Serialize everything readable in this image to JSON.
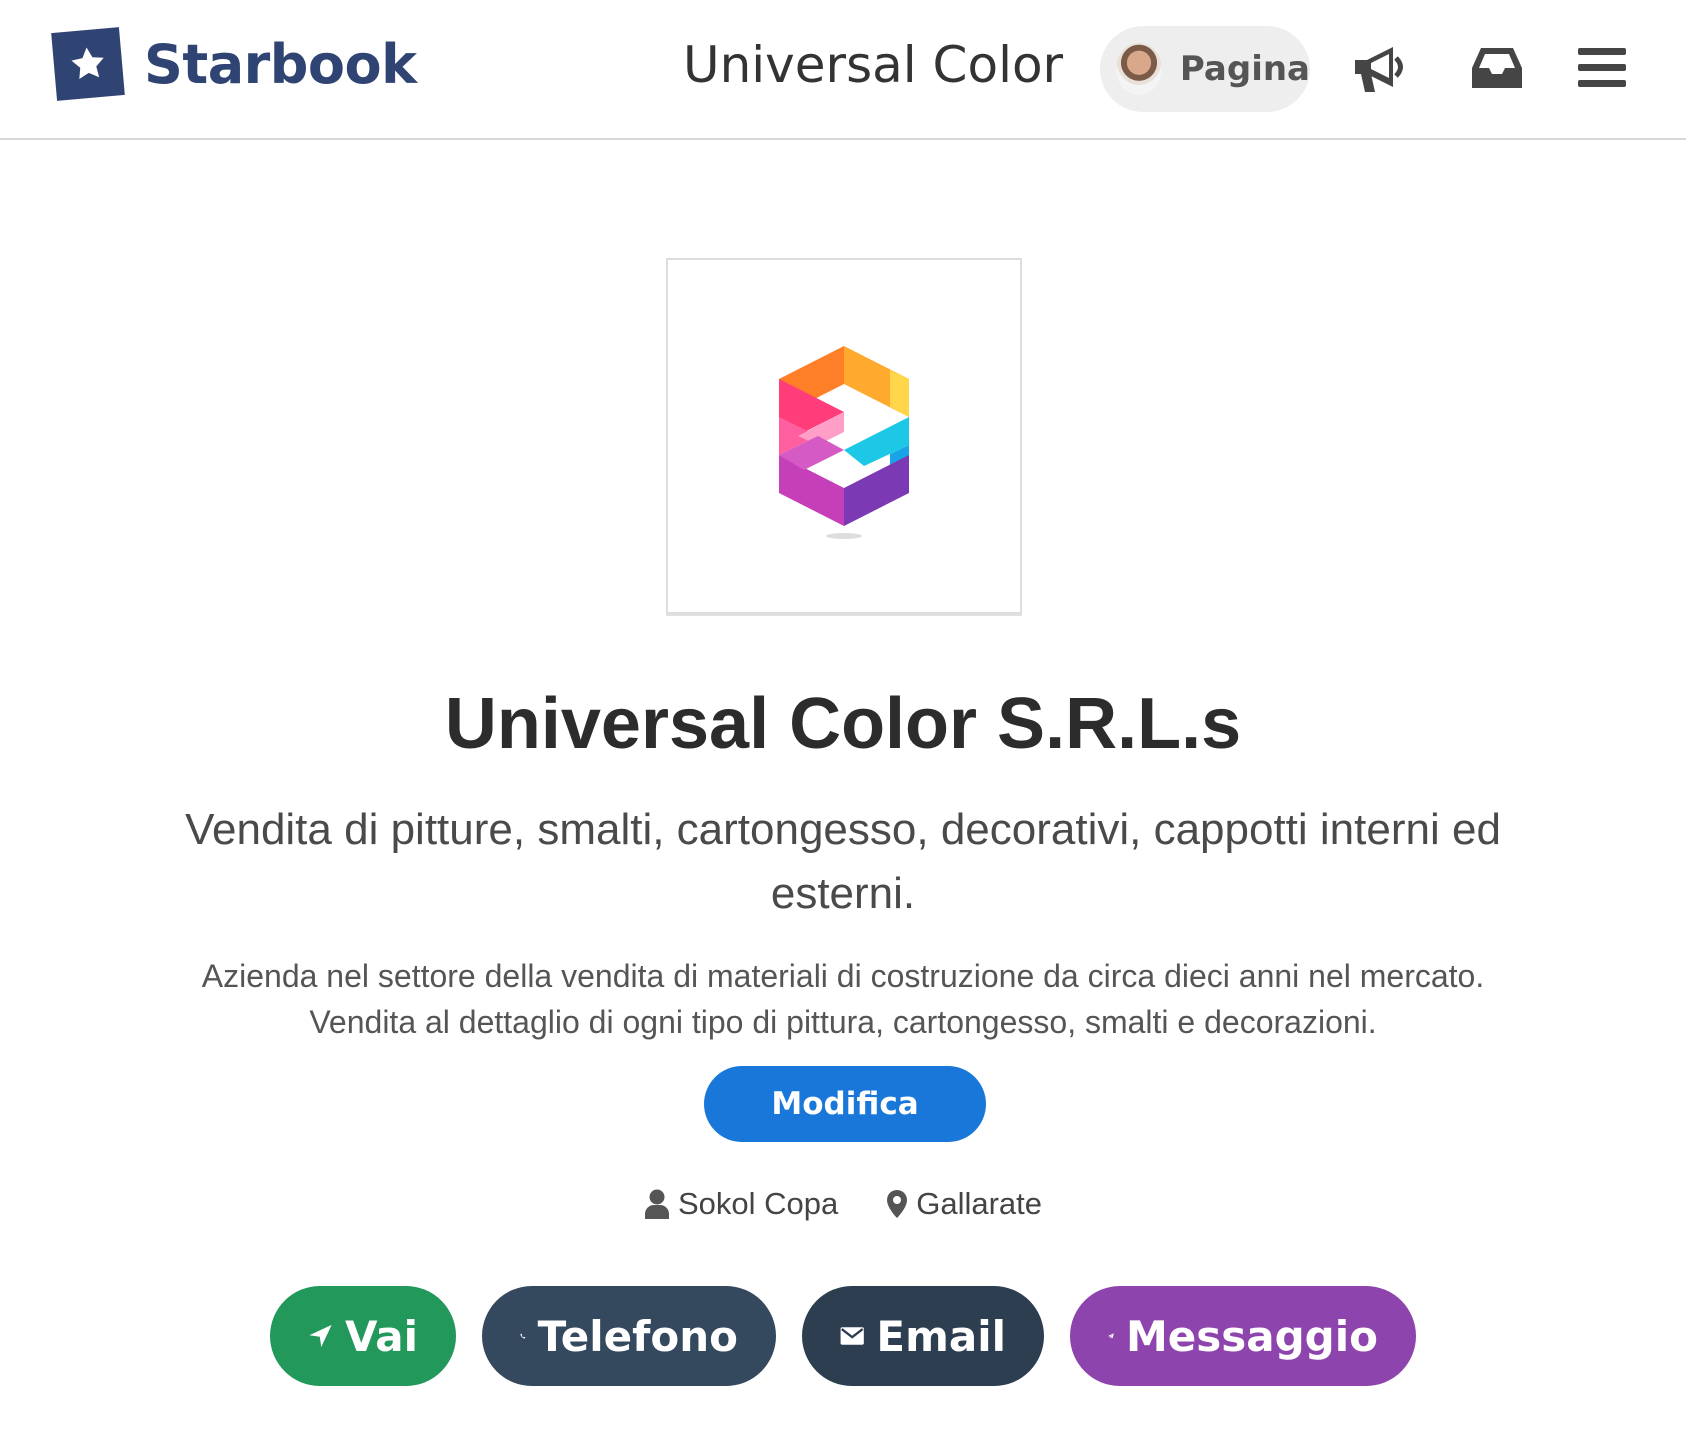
{
  "brand": {
    "name": "Starbook"
  },
  "header": {
    "page_title": "Universal Color",
    "pagina_label": "Pagina"
  },
  "profile": {
    "title": "Universal Color S.R.L.s",
    "subtitle": "Vendita di pitture, smalti, cartongesso, decorativi, cappotti interni ed esterni.",
    "description_line1": "Azienda nel settore della vendita di materiali di costruzione da circa dieci anni nel mercato.",
    "description_line2": "Vendita al dettaglio di ogni tipo di pittura, cartongesso, smalti e decorazioni.",
    "edit_label": "Modifica",
    "owner": "Sokol Copa",
    "location": "Gallarate"
  },
  "actions": {
    "vai": "Vai",
    "telefono": "Telefono",
    "email": "Email",
    "messaggio": "Messaggio"
  },
  "colors": {
    "brand": "#2f4472",
    "edit_button": "#1877d8",
    "vai": "#22985a",
    "telefono": "#34495e",
    "email": "#2c3e50",
    "messaggio": "#8e44ad"
  },
  "icons": {
    "brand": "star-icon",
    "notifications": "megaphone-icon",
    "inbox": "inbox-icon",
    "menu": "hamburger-menu-icon",
    "owner": "user-icon",
    "location": "map-pin-icon",
    "vai": "location-arrow-icon",
    "telefono": "phone-icon",
    "email": "envelope-icon",
    "messaggio": "paper-plane-icon"
  }
}
